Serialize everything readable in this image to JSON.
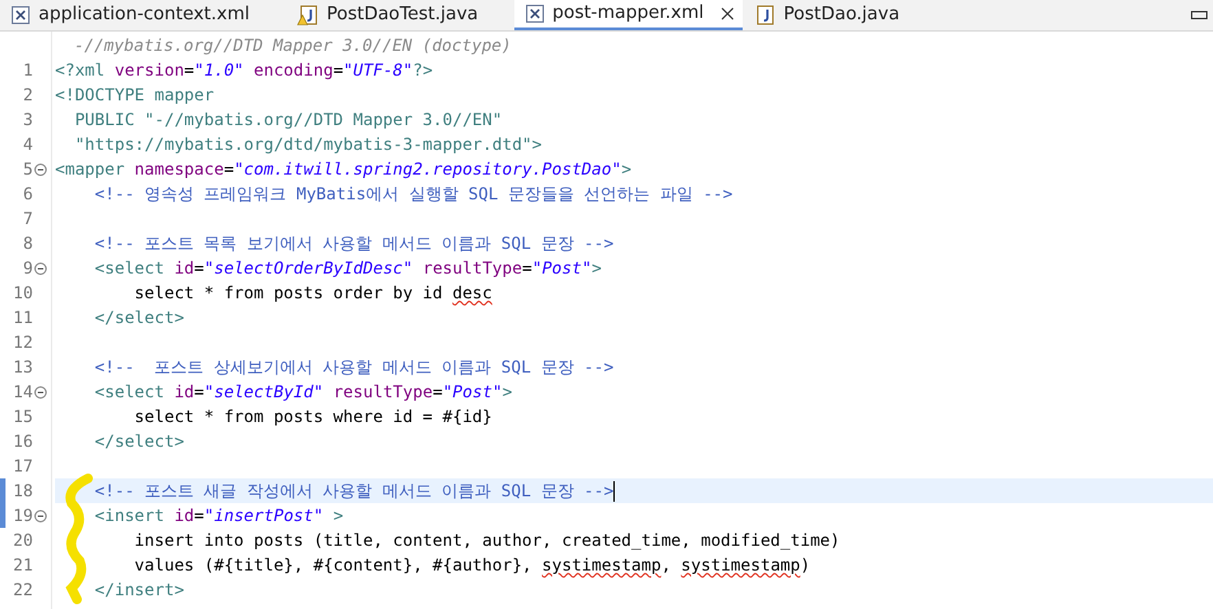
{
  "tabs": [
    {
      "label": "application-context.xml",
      "kind": "xml",
      "warning": false,
      "selected": false,
      "closable": false
    },
    {
      "label": "PostDaoTest.java",
      "kind": "java",
      "warning": true,
      "selected": false,
      "closable": false
    },
    {
      "label": "post-mapper.xml",
      "kind": "xml",
      "warning": false,
      "selected": true,
      "closable": true
    },
    {
      "label": "PostDao.java",
      "kind": "java",
      "warning": false,
      "selected": false,
      "closable": false
    }
  ],
  "editor": {
    "hint": "-//mybatis.org//DTD Mapper 3.0//EN (doctype)",
    "lines": [
      {
        "number": "1",
        "foldable": false,
        "changed": false,
        "current": false,
        "tokens": [
          {
            "kind": "tag",
            "text": "<?xml"
          },
          {
            "kind": "attr",
            "text": " version"
          },
          {
            "kind": "punct",
            "text": "="
          },
          {
            "kind": "value",
            "text": "\"1.0\""
          },
          {
            "kind": "attr",
            "text": " encoding"
          },
          {
            "kind": "punct",
            "text": "="
          },
          {
            "kind": "value",
            "text": "\"UTF-8\""
          },
          {
            "kind": "tag",
            "text": "?>"
          }
        ]
      },
      {
        "number": "2",
        "foldable": false,
        "changed": false,
        "current": false,
        "tokens": [
          {
            "kind": "tag",
            "text": "<!DOCTYPE mapper"
          }
        ]
      },
      {
        "number": "3",
        "foldable": false,
        "changed": false,
        "current": false,
        "tokens": [
          {
            "kind": "tag",
            "text": "  PUBLIC \"-//mybatis.org//DTD Mapper 3.0//EN\""
          }
        ]
      },
      {
        "number": "4",
        "foldable": false,
        "changed": false,
        "current": false,
        "tokens": [
          {
            "kind": "tag",
            "text": "  \"https://mybatis.org/dtd/mybatis-3-mapper.dtd\">"
          }
        ]
      },
      {
        "number": "5",
        "foldable": true,
        "changed": false,
        "current": false,
        "tokens": [
          {
            "kind": "tag",
            "text": "<mapper"
          },
          {
            "kind": "attr",
            "text": " namespace"
          },
          {
            "kind": "punct",
            "text": "="
          },
          {
            "kind": "value",
            "text": "\"com.itwill.spring2.repository.PostDao\""
          },
          {
            "kind": "tag",
            "text": ">"
          }
        ]
      },
      {
        "number": "6",
        "foldable": false,
        "changed": false,
        "current": false,
        "tokens": [
          {
            "kind": "comment",
            "text": "    <!-- 영속성 프레임워크 MyBatis에서 실행할 SQL 문장들을 선언하는 파일 -->"
          }
        ]
      },
      {
        "number": "7",
        "foldable": false,
        "changed": false,
        "current": false
      },
      {
        "number": "8",
        "foldable": false,
        "changed": false,
        "current": false,
        "tokens": [
          {
            "kind": "comment",
            "text": "    <!-- 포스트 목록 보기에서 사용할 메서드 이름과 SQL 문장 -->"
          }
        ]
      },
      {
        "number": "9",
        "foldable": true,
        "changed": false,
        "current": false,
        "tokens": [
          {
            "kind": "tag",
            "text": "    <select"
          },
          {
            "kind": "attr",
            "text": " id"
          },
          {
            "kind": "punct",
            "text": "="
          },
          {
            "kind": "value",
            "text": "\"selectOrderByIdDesc\""
          },
          {
            "kind": "attr",
            "text": " resultType"
          },
          {
            "kind": "punct",
            "text": "="
          },
          {
            "kind": "value",
            "text": "\"Post\""
          },
          {
            "kind": "tag",
            "text": ">"
          }
        ]
      },
      {
        "number": "10",
        "foldable": false,
        "changed": false,
        "current": false,
        "tokens": [
          {
            "kind": "text",
            "text": "        select * from posts order by id "
          },
          {
            "kind": "text",
            "text": "desc",
            "misspelled": true
          }
        ]
      },
      {
        "number": "11",
        "foldable": false,
        "changed": false,
        "current": false,
        "tokens": [
          {
            "kind": "tag",
            "text": "    </select>"
          }
        ]
      },
      {
        "number": "12",
        "foldable": false,
        "changed": false,
        "current": false
      },
      {
        "number": "13",
        "foldable": false,
        "changed": false,
        "current": false,
        "tokens": [
          {
            "kind": "comment",
            "text": "    <!--  포스트 상세보기에서 사용할 메서드 이름과 SQL 문장 -->"
          }
        ]
      },
      {
        "number": "14",
        "foldable": true,
        "changed": false,
        "current": false,
        "tokens": [
          {
            "kind": "tag",
            "text": "    <select"
          },
          {
            "kind": "attr",
            "text": " id"
          },
          {
            "kind": "punct",
            "text": "="
          },
          {
            "kind": "value",
            "text": "\"selectById\""
          },
          {
            "kind": "attr",
            "text": " resultType"
          },
          {
            "kind": "punct",
            "text": "="
          },
          {
            "kind": "value",
            "text": "\"Post\""
          },
          {
            "kind": "tag",
            "text": ">"
          }
        ]
      },
      {
        "number": "15",
        "foldable": false,
        "changed": false,
        "current": false,
        "tokens": [
          {
            "kind": "text",
            "text": "        select * from posts where id = #{id}"
          }
        ]
      },
      {
        "number": "16",
        "foldable": false,
        "changed": false,
        "current": false,
        "tokens": [
          {
            "kind": "tag",
            "text": "    </select>"
          }
        ]
      },
      {
        "number": "17",
        "foldable": false,
        "changed": false,
        "current": false
      },
      {
        "number": "18",
        "foldable": false,
        "changed": true,
        "current": true,
        "tokens": [
          {
            "kind": "comment",
            "text": "    <!-- 포스트 새글 작성에서 사용할 메서드 이름과 SQL 문장 -->"
          }
        ]
      },
      {
        "number": "19",
        "foldable": true,
        "changed": true,
        "current": false,
        "tokens": [
          {
            "kind": "tag",
            "text": "    <insert"
          },
          {
            "kind": "attr",
            "text": " id"
          },
          {
            "kind": "punct",
            "text": "="
          },
          {
            "kind": "value",
            "text": "\"insertPost\""
          },
          {
            "kind": "tag",
            "text": " >"
          }
        ]
      },
      {
        "number": "20",
        "foldable": false,
        "changed": false,
        "current": false,
        "tokens": [
          {
            "kind": "text",
            "text": "        insert into posts (title, content, author, created_time, modified_time)"
          }
        ]
      },
      {
        "number": "21",
        "foldable": false,
        "changed": false,
        "current": false,
        "tokens": [
          {
            "kind": "text",
            "text": "        values (#{title}, #{content}, #{author}, "
          },
          {
            "kind": "text",
            "text": "systimestamp",
            "misspelled": true
          },
          {
            "kind": "text",
            "text": ", "
          },
          {
            "kind": "text",
            "text": "systimestamp",
            "misspelled": true
          },
          {
            "kind": "text",
            "text": ")"
          }
        ]
      },
      {
        "number": "22",
        "foldable": false,
        "changed": false,
        "current": false,
        "tokens": [
          {
            "kind": "tag",
            "text": "    </insert>"
          }
        ]
      }
    ]
  }
}
